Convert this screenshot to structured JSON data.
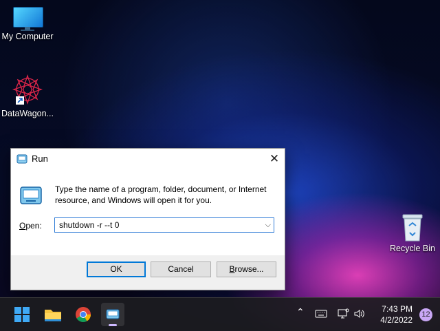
{
  "desktop": {
    "icons": [
      {
        "label": "My Computer"
      },
      {
        "label": "DataWagon..."
      },
      {
        "label": "Recycle Bin"
      }
    ]
  },
  "run_dialog": {
    "title": "Run",
    "description": "Type the name of a program, folder, document, or Internet resource, and Windows will open it for you.",
    "open_label": "Open:",
    "open_label_accel": "O",
    "open_label_rest": "pen:",
    "command_value": "shutdown -r --t 0",
    "ok_label": "OK",
    "cancel_label": "Cancel",
    "browse_label": "Browse...",
    "browse_accel": "B",
    "browse_rest": "rowse..."
  },
  "taskbar": {
    "time": "7:43 PM",
    "date": "4/2/2022",
    "notification_count": "12",
    "apps": [
      "start-icon",
      "file-explorer-icon",
      "chrome-icon",
      "run-icon"
    ],
    "accent": "#cdb9ff"
  }
}
